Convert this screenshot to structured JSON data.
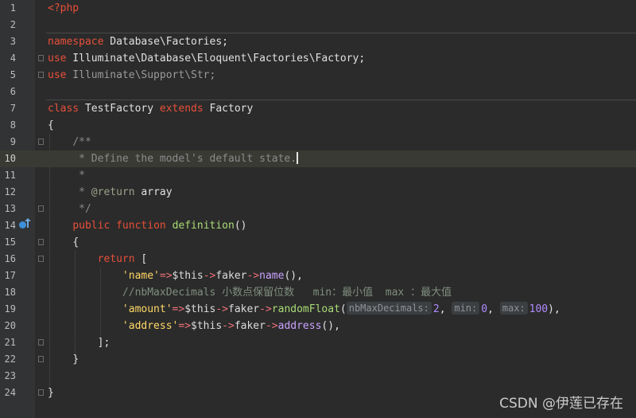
{
  "editor": {
    "line_numbers": [
      "1",
      "2",
      "3",
      "4",
      "5",
      "6",
      "7",
      "8",
      "9",
      "10",
      "11",
      "12",
      "13",
      "14",
      "15",
      "16",
      "17",
      "18",
      "19",
      "20",
      "21",
      "22",
      "23",
      "24"
    ],
    "current_line": "10",
    "code": {
      "l1_php_open": "<?php",
      "l3_namespace_kw": "namespace",
      "l3_namespace_name": " Database\\Factories;",
      "l4_use_kw": "use",
      "l4_use_path": " Illuminate\\Database\\Eloquent\\Factories\\Factory;",
      "l5_use_kw": "use",
      "l5_use_path": " Illuminate\\Support\\Str;",
      "l7_class_kw": "class",
      "l7_class_name": " TestFactory ",
      "l7_extends_kw": "extends",
      "l7_parent": " Factory",
      "l8_brace": "{",
      "l9_doc_open": "/**",
      "l10_doc_text": " * Define the model's default state.",
      "l11_doc_star": " *",
      "l12_doc_star": " * ",
      "l12_doc_tag": "@return",
      "l12_doc_type": " array",
      "l13_doc_close": " */",
      "l14_public_kw": "public",
      "l14_function_kw": " function ",
      "l14_fn_name": "definition",
      "l14_parens": "()",
      "l15_brace": "{",
      "l16_return_kw": "return",
      "l16_bracket": " [",
      "l17_key": "'name'",
      "l17_arrow": "=>",
      "l17_this": "$this",
      "l17_op1": "->",
      "l17_prop": "faker",
      "l17_op2": "->",
      "l17_call": "name",
      "l17_tail": "(),",
      "l18_comment": "//nbMaxDecimals 小数点保留位数   min：最小值  max ：最大值",
      "l19_key": "'amount'",
      "l19_arrow": "=>",
      "l19_this": "$this",
      "l19_op1": "->",
      "l19_prop": "faker",
      "l19_op2": "->",
      "l19_call": "randomFloat",
      "l19_open": "(",
      "l19_hint1": "nbMaxDecimals:",
      "l19_arg1": "2",
      "l19_comma1": ", ",
      "l19_hint2": "min:",
      "l19_arg2": "0",
      "l19_comma2": ", ",
      "l19_hint3": "max:",
      "l19_arg3": "100",
      "l19_tail": "),",
      "l20_key": "'address'",
      "l20_arrow": "=>",
      "l20_this": "$this",
      "l20_op1": "->",
      "l20_prop": "faker",
      "l20_op2": "->",
      "l20_call": "address",
      "l20_tail": "(),",
      "l21_close": "];",
      "l22_brace": "}",
      "l24_brace": "}"
    }
  },
  "watermark": "CSDN @伊莲已存在",
  "icons": {
    "line14_gutter": "implements-method-icon"
  }
}
